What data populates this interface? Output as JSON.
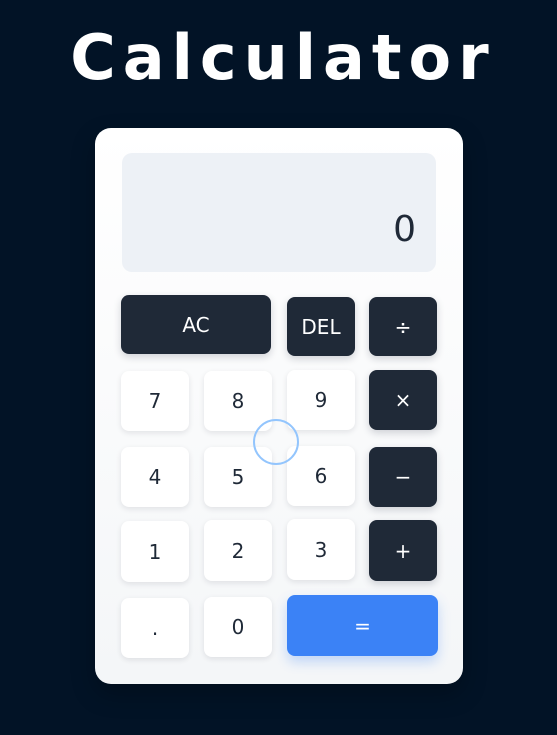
{
  "page": {
    "title": "Calculator"
  },
  "display": {
    "value": "0"
  },
  "buttons": {
    "ac": "AC",
    "del": "DEL",
    "divide": "÷",
    "seven": "7",
    "eight": "8",
    "nine": "9",
    "multiply": "×",
    "four": "4",
    "five": "5",
    "six": "6",
    "subtract": "−",
    "one": "1",
    "two": "2",
    "three": "3",
    "add": "+",
    "decimal": ".",
    "zero": "0",
    "equals": "="
  },
  "colors": {
    "background": "#021326",
    "panel": "#ffffff",
    "display": "#edf1f6",
    "dark_button": "#1f2937",
    "accent": "#3b82f6"
  }
}
